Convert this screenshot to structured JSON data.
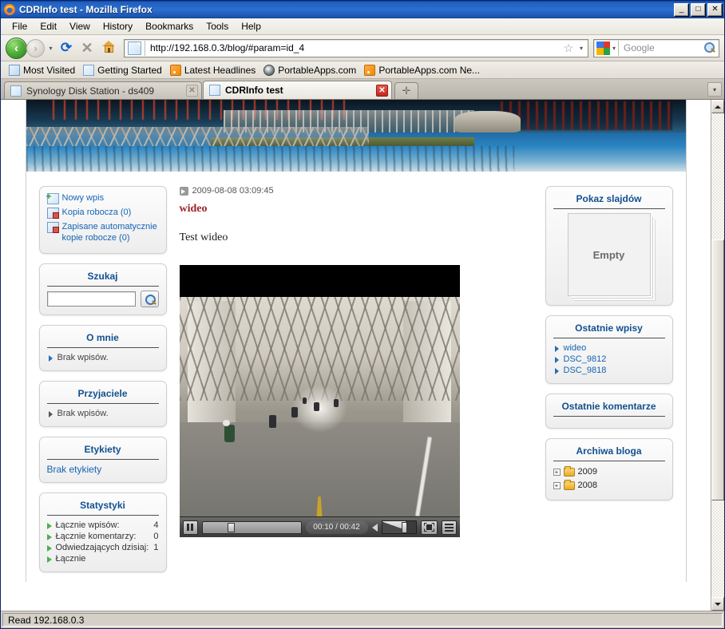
{
  "window": {
    "title": "CDRInfo test - Mozilla Firefox",
    "minimize_label": "_",
    "maximize_label": "□",
    "close_label": "✕"
  },
  "menubar": {
    "items": [
      {
        "label": "File"
      },
      {
        "label": "Edit"
      },
      {
        "label": "View"
      },
      {
        "label": "History"
      },
      {
        "label": "Bookmarks"
      },
      {
        "label": "Tools"
      },
      {
        "label": "Help"
      }
    ]
  },
  "navbar": {
    "back_label": "‹",
    "forward_label": "›",
    "history_dropdown_label": "▾",
    "reload_label": "⟳",
    "stop_label": "✕",
    "home_icon": "home-icon",
    "url": "http://192.168.0.3/blog/#param=id_4",
    "bookmark_star_label": "☆",
    "url_dropdown_label": "▾",
    "search_engine": "Google",
    "search_dropdown_label": "▾"
  },
  "bookmarks_toolbar": {
    "items": [
      {
        "label": "Most Visited",
        "icon": "most-visited-icon"
      },
      {
        "label": "Getting Started",
        "icon": "doc-icon"
      },
      {
        "label": "Latest Headlines",
        "icon": "rss-icon"
      },
      {
        "label": "PortableApps.com",
        "icon": "portableapps-icon"
      },
      {
        "label": "PortableApps.com Ne...",
        "icon": "rss-icon"
      }
    ]
  },
  "tabs": {
    "items": [
      {
        "label": "Synology Disk Station - ds409",
        "active": false,
        "close_label": "✕"
      },
      {
        "label": "CDRInfo test",
        "active": true,
        "close_label": "✕"
      }
    ],
    "new_tab_label": "✛",
    "tab_list_label": "▾"
  },
  "page": {
    "left_sidebar": {
      "actions": {
        "items": [
          {
            "label": "Nowy wpis",
            "icon": "new-post-icon"
          },
          {
            "label": "Kopia robocza (0)",
            "icon": "draft-icon"
          },
          {
            "label": "Zapisane automatycznie kopie robocze (0)",
            "icon": "autosave-draft-icon"
          }
        ]
      },
      "search": {
        "title": "Szukaj",
        "value": "",
        "button_icon": "magnifier-icon"
      },
      "about": {
        "title": "O mnie",
        "empty_text": "Brak wpisów."
      },
      "friends": {
        "title": "Przyjaciele",
        "empty_text": "Brak wpisów."
      },
      "tags": {
        "title": "Etykiety",
        "empty_text": "Brak etykiety"
      },
      "stats": {
        "title": "Statystyki",
        "rows": [
          {
            "label": "Łącznie wpisów:",
            "value": "4"
          },
          {
            "label": "Łącznie komentarzy:",
            "value": "0"
          },
          {
            "label": "Odwiedzających dzisiaj:",
            "value": "1"
          },
          {
            "label": "Łącznie",
            "value": ""
          }
        ]
      }
    },
    "post": {
      "date": "2009-08-08 03:09:45",
      "title": "wideo",
      "body": "Test wideo"
    },
    "player": {
      "time_display": "00:10 / 00:42",
      "pause_label": "pause",
      "fullscreen_label": "fullscreen",
      "menu_label": "menu",
      "progress_percent": 26,
      "volume_percent": 55
    },
    "right_sidebar": {
      "slideshow": {
        "title": "Pokaz slajdów",
        "empty_text": "Empty"
      },
      "recent_posts": {
        "title": "Ostatnie wpisy",
        "items": [
          {
            "label": "wideo"
          },
          {
            "label": "DSC_9812"
          },
          {
            "label": "DSC_9818"
          }
        ]
      },
      "recent_comments": {
        "title": "Ostatnie komentarze"
      },
      "archives": {
        "title": "Archiwa bloga",
        "items": [
          {
            "label": "2009",
            "expand_label": "+"
          },
          {
            "label": "2008",
            "expand_label": "+"
          }
        ]
      }
    }
  },
  "statusbar": {
    "text": "Read 192.168.0.3"
  },
  "colors": {
    "titlebar_blue": "#2b6fd0",
    "link_blue": "#1464b4",
    "heading_blue": "#12508f",
    "post_title_red": "#9b2226",
    "accent_green": "#4caf50"
  }
}
